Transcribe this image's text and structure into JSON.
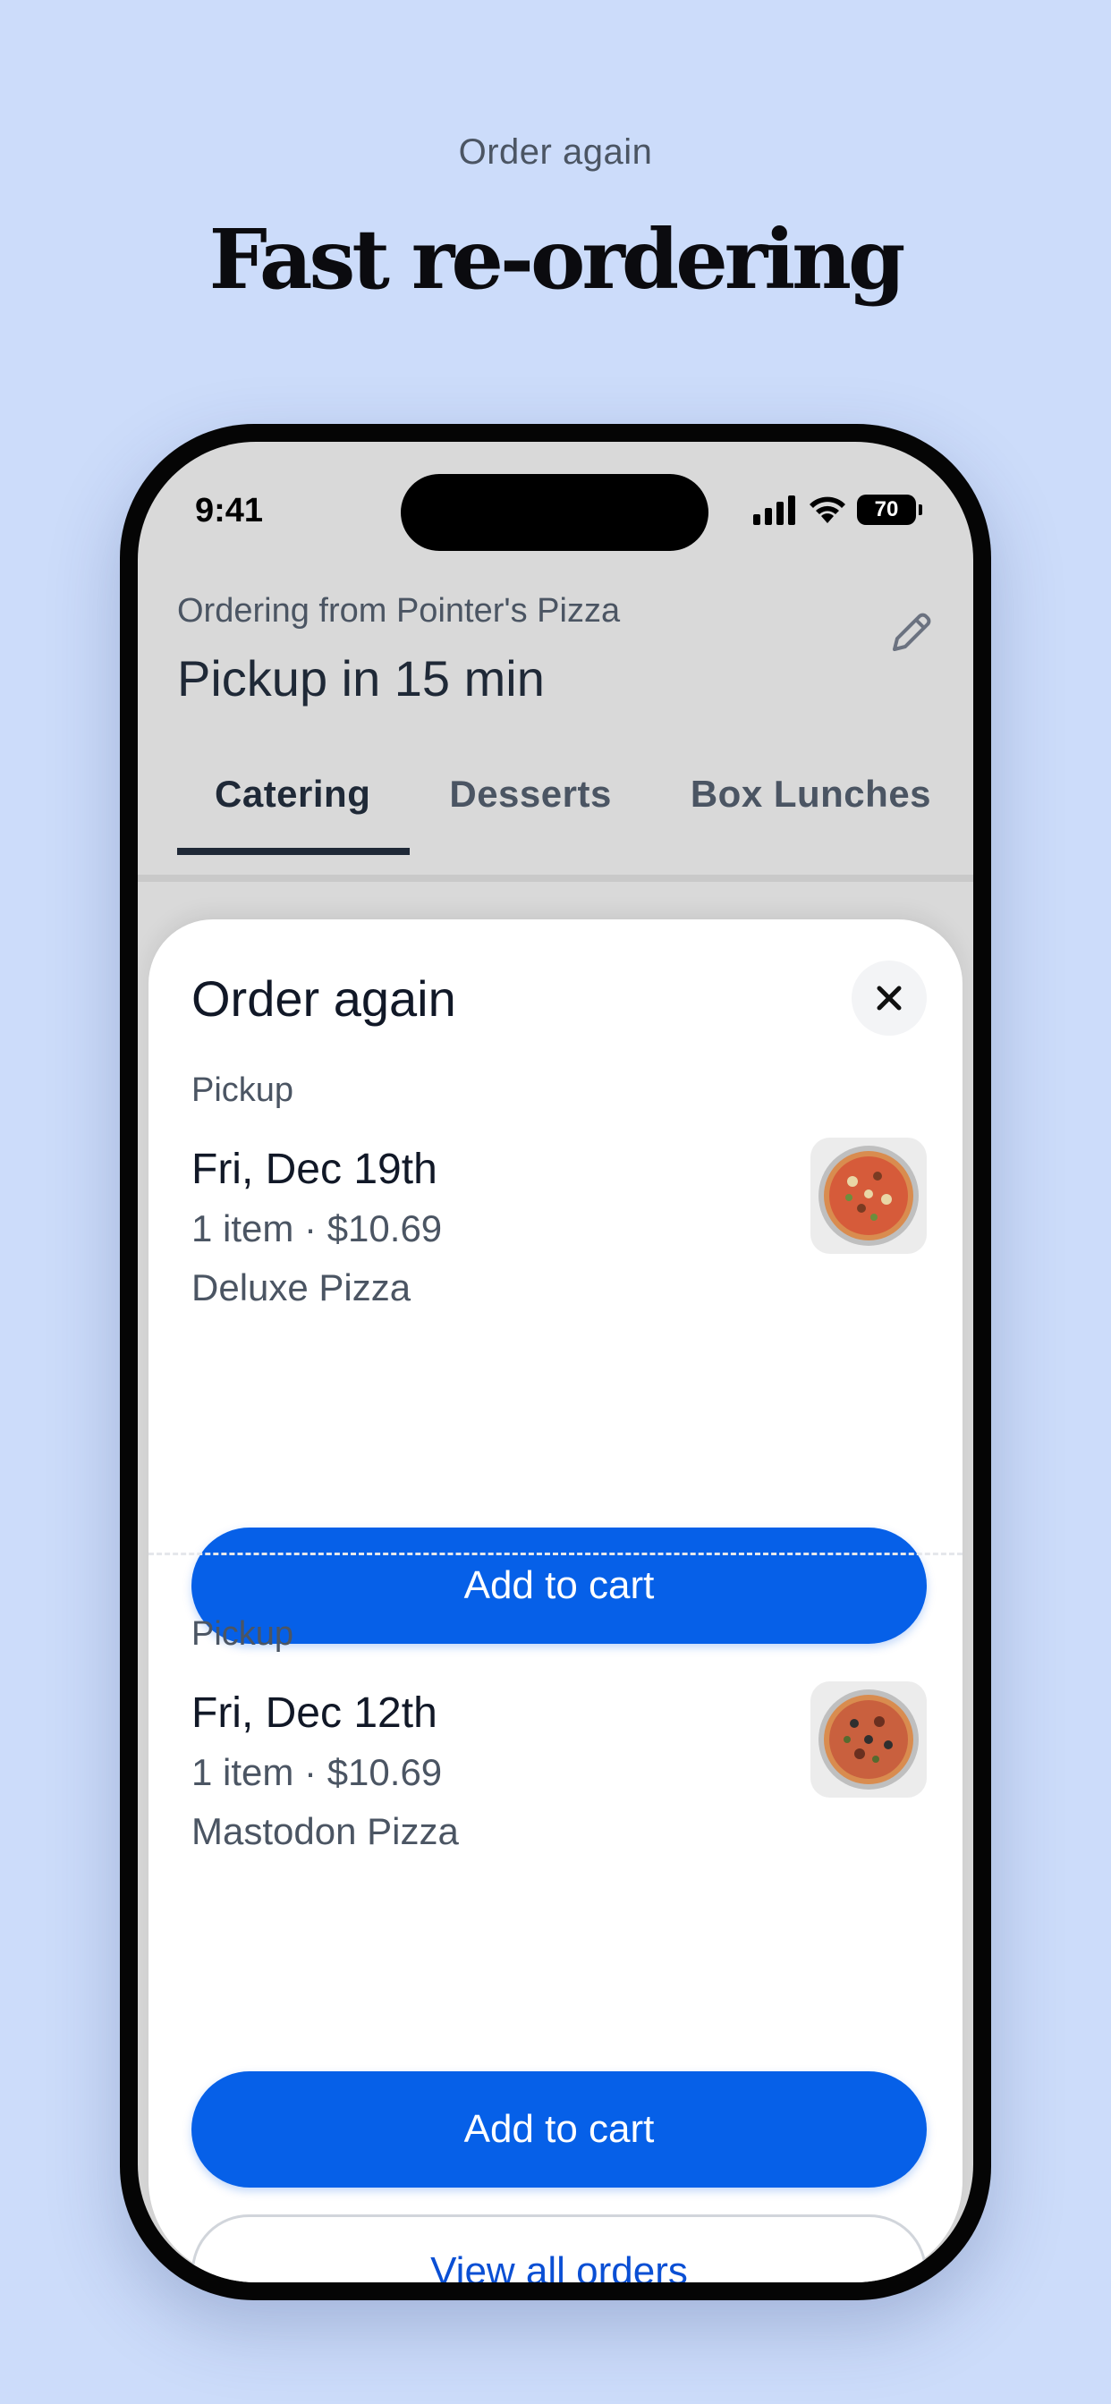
{
  "promo": {
    "eyebrow": "Order again",
    "headline": "Fast re-ordering"
  },
  "status_bar": {
    "time": "9:41",
    "battery": "70",
    "icons": [
      "signal-icon",
      "wifi-icon",
      "battery-icon"
    ]
  },
  "header": {
    "ordering_from": "Ordering from Pointer's Pizza",
    "pickup_time": "Pickup in 15 min",
    "edit_icon": "pencil-icon"
  },
  "tabs": [
    {
      "label": "Catering",
      "active": true
    },
    {
      "label": "Desserts",
      "active": false
    },
    {
      "label": "Box Lunches",
      "active": false
    }
  ],
  "sheet": {
    "title": "Order again",
    "close_icon": "close-icon",
    "orders": [
      {
        "type": "Pickup",
        "date": "Fri, Dec 19th",
        "meta": "1 item · $10.69",
        "name": "Deluxe Pizza",
        "button": "Add to cart"
      },
      {
        "type": "Pickup",
        "date": "Fri, Dec 12th",
        "meta": "1 item · $10.69",
        "name": "Mastodon Pizza",
        "button": "Add to cart"
      }
    ],
    "view_all": "View all orders"
  },
  "colors": {
    "background": "#ccdcfa",
    "primary": "#0660e8",
    "link": "#0a4fd4"
  }
}
